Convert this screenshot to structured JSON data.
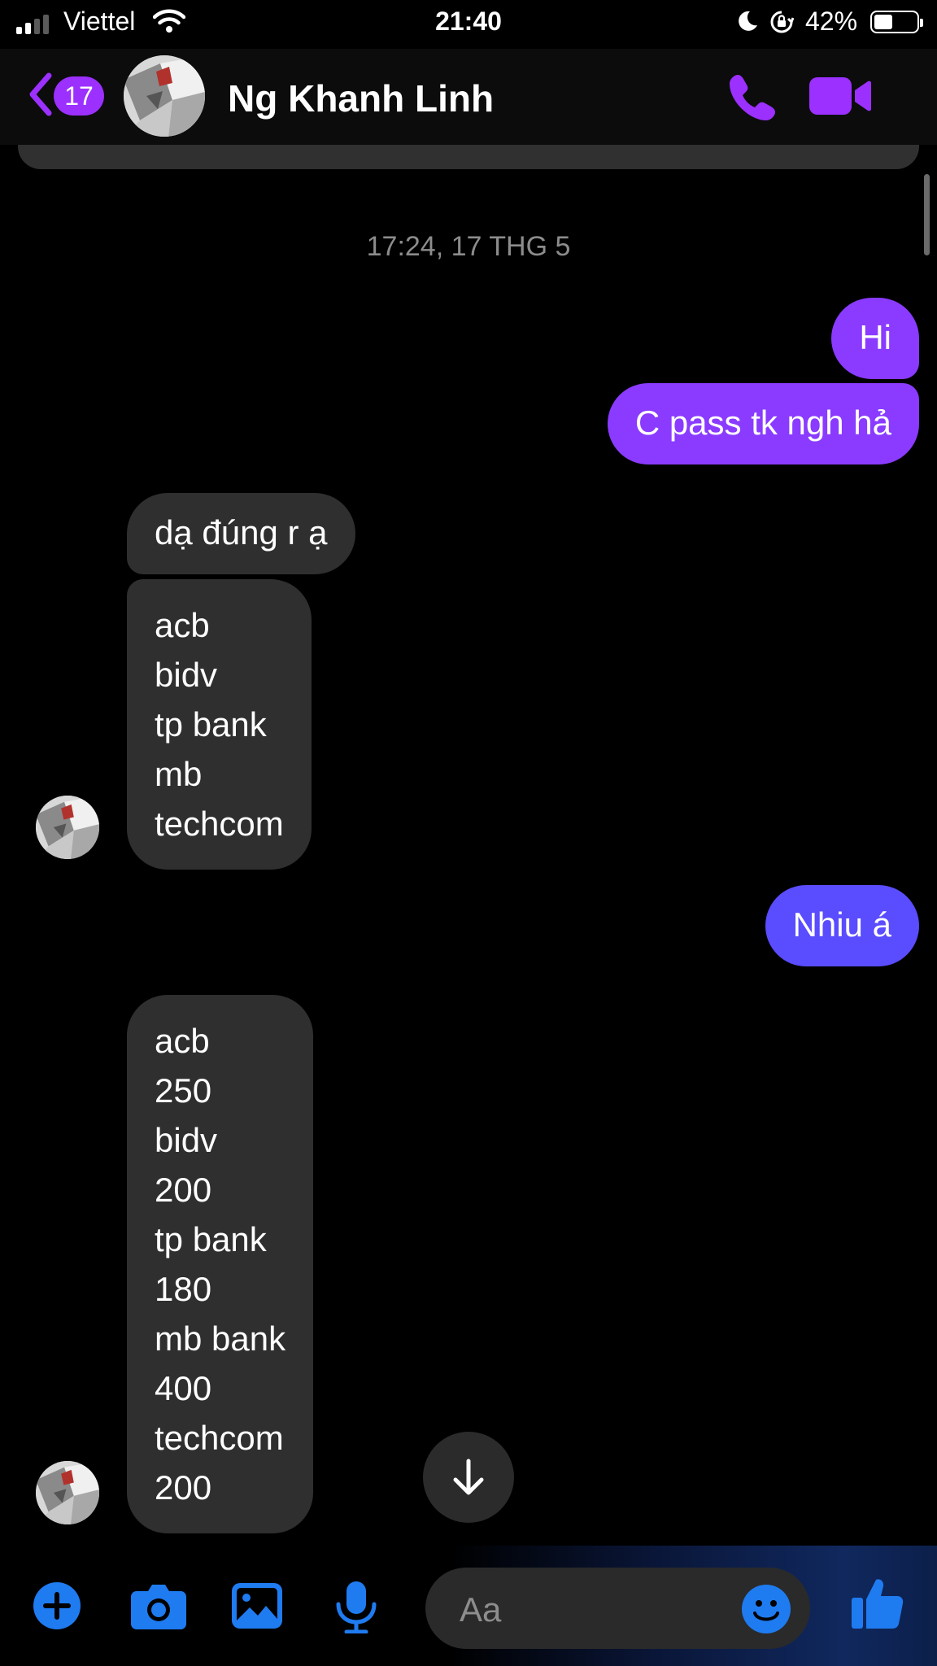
{
  "status_bar": {
    "carrier": "Viettel",
    "time": "21:40",
    "battery_percent": "42%",
    "signal_bars": 2
  },
  "header": {
    "unread_count": "17",
    "contact_name": "Ng Khanh Linh",
    "accent_color": "#9b30ff"
  },
  "conversation": {
    "timestamp": "17:24, 17 THG 5",
    "messages": [
      {
        "from": "me",
        "lines": [
          "Hi"
        ]
      },
      {
        "from": "me",
        "lines": [
          "C pass tk ngh hả"
        ]
      },
      {
        "from": "them",
        "lines": [
          "dạ đúng r ạ"
        ]
      },
      {
        "from": "them",
        "lines": [
          "acb",
          "bidv",
          "tp bank",
          "mb",
          "techcom"
        ]
      },
      {
        "from": "me",
        "lines": [
          "Nhiu á"
        ]
      },
      {
        "from": "them",
        "lines": [
          "acb",
          "250",
          "bidv",
          "200",
          "tp bank",
          "180",
          "mb bank",
          "400",
          "techcom",
          "200"
        ]
      }
    ]
  },
  "composer": {
    "placeholder": "Aa",
    "icons": [
      "plus-icon",
      "camera-icon",
      "gallery-icon",
      "microphone-icon",
      "emoji-icon",
      "thumbs-up-icon"
    ],
    "icon_color": "#1f7bf0"
  }
}
